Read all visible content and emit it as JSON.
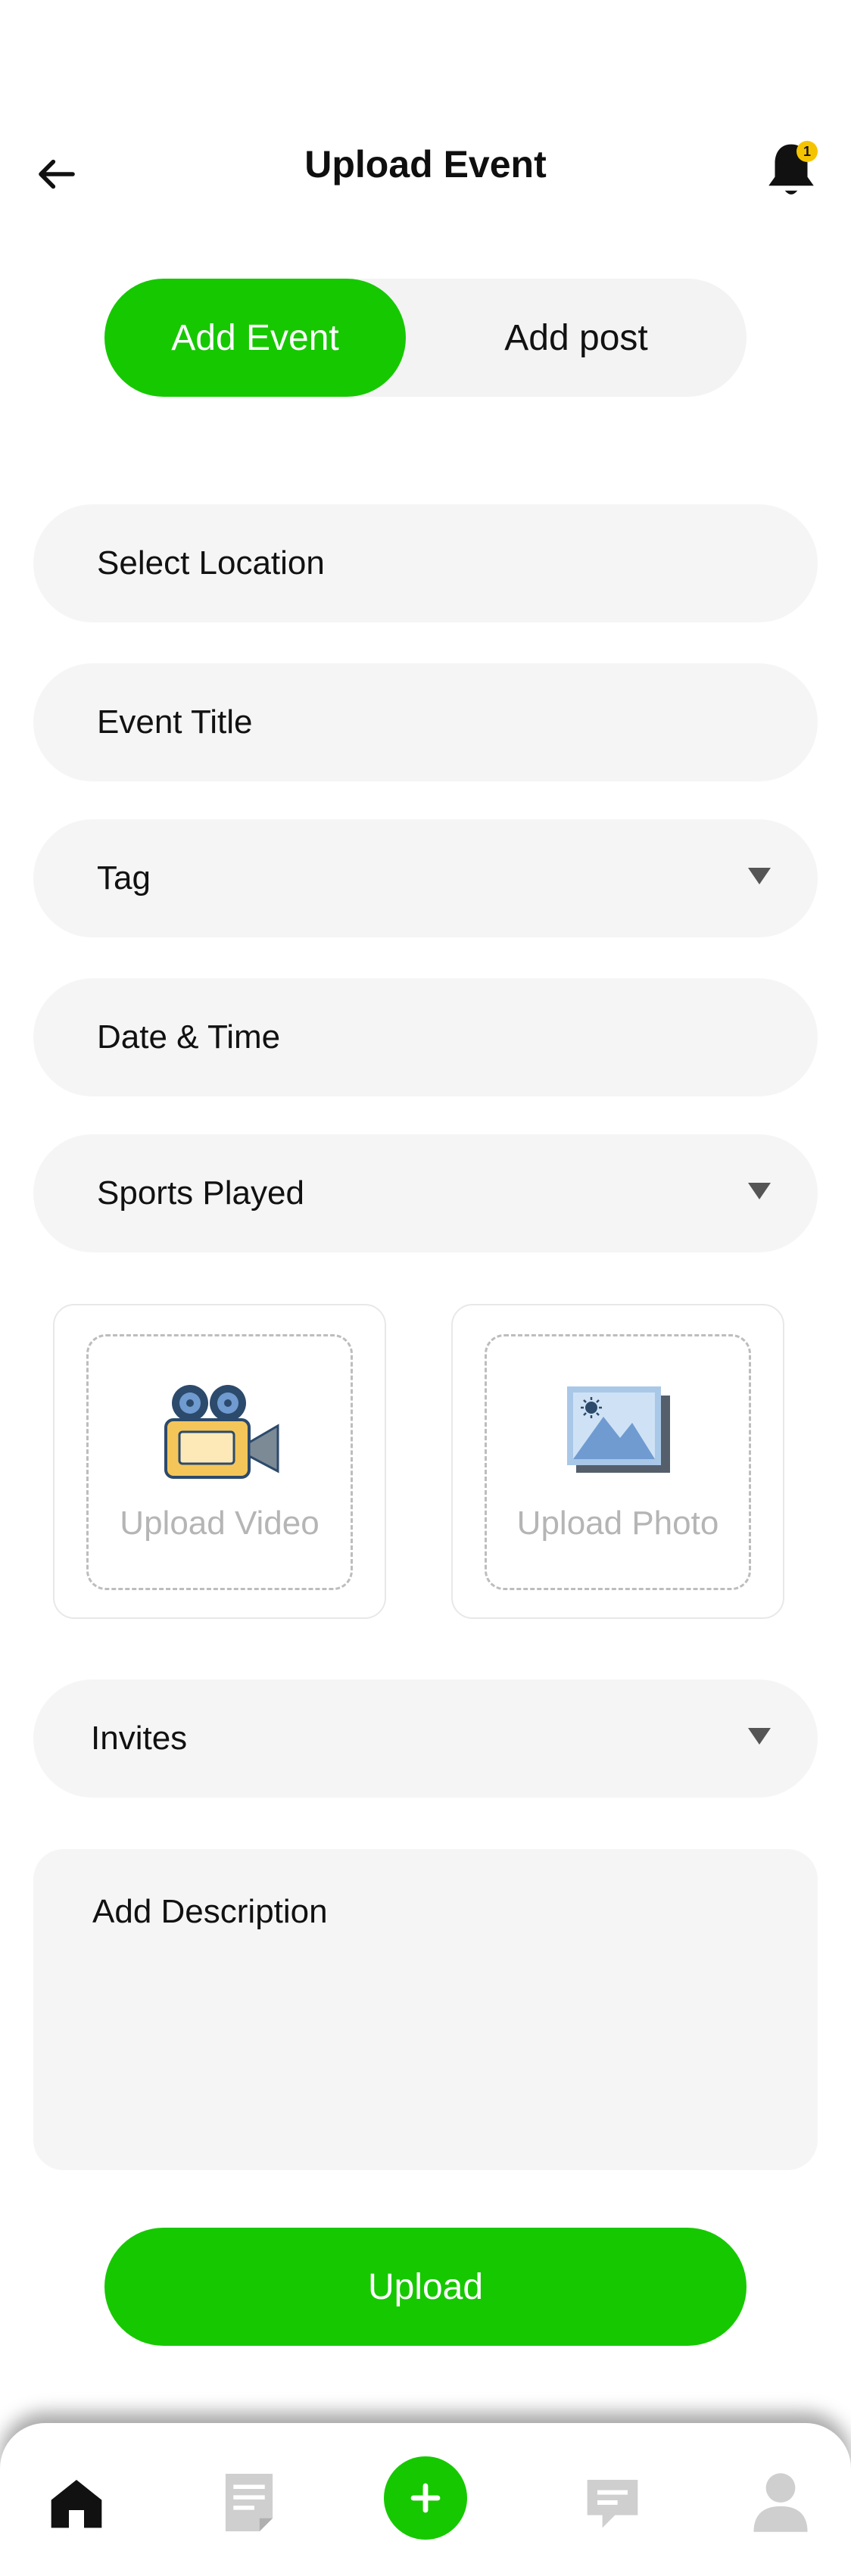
{
  "header": {
    "title": "Upload Event",
    "notification_count": "1"
  },
  "toggle": {
    "active_label": "Add Event",
    "inactive_label": "Add post"
  },
  "form": {
    "location": "Select Location",
    "event_title": "Event Title",
    "tag": "Tag",
    "date_time": "Date & Time",
    "sports_played": "Sports Played",
    "upload_video": "Upload Video",
    "upload_photo": "Upload Photo",
    "invites": "Invites",
    "description": "Add Description"
  },
  "actions": {
    "upload_label": "Upload"
  },
  "colors": {
    "accent": "#16c800",
    "field_bg": "#f5f5f5",
    "badge": "#f5c400"
  },
  "nav": {
    "icons": [
      "home-icon",
      "document-icon",
      "plus-icon",
      "chat-icon",
      "profile-icon"
    ],
    "active": "home-icon"
  }
}
